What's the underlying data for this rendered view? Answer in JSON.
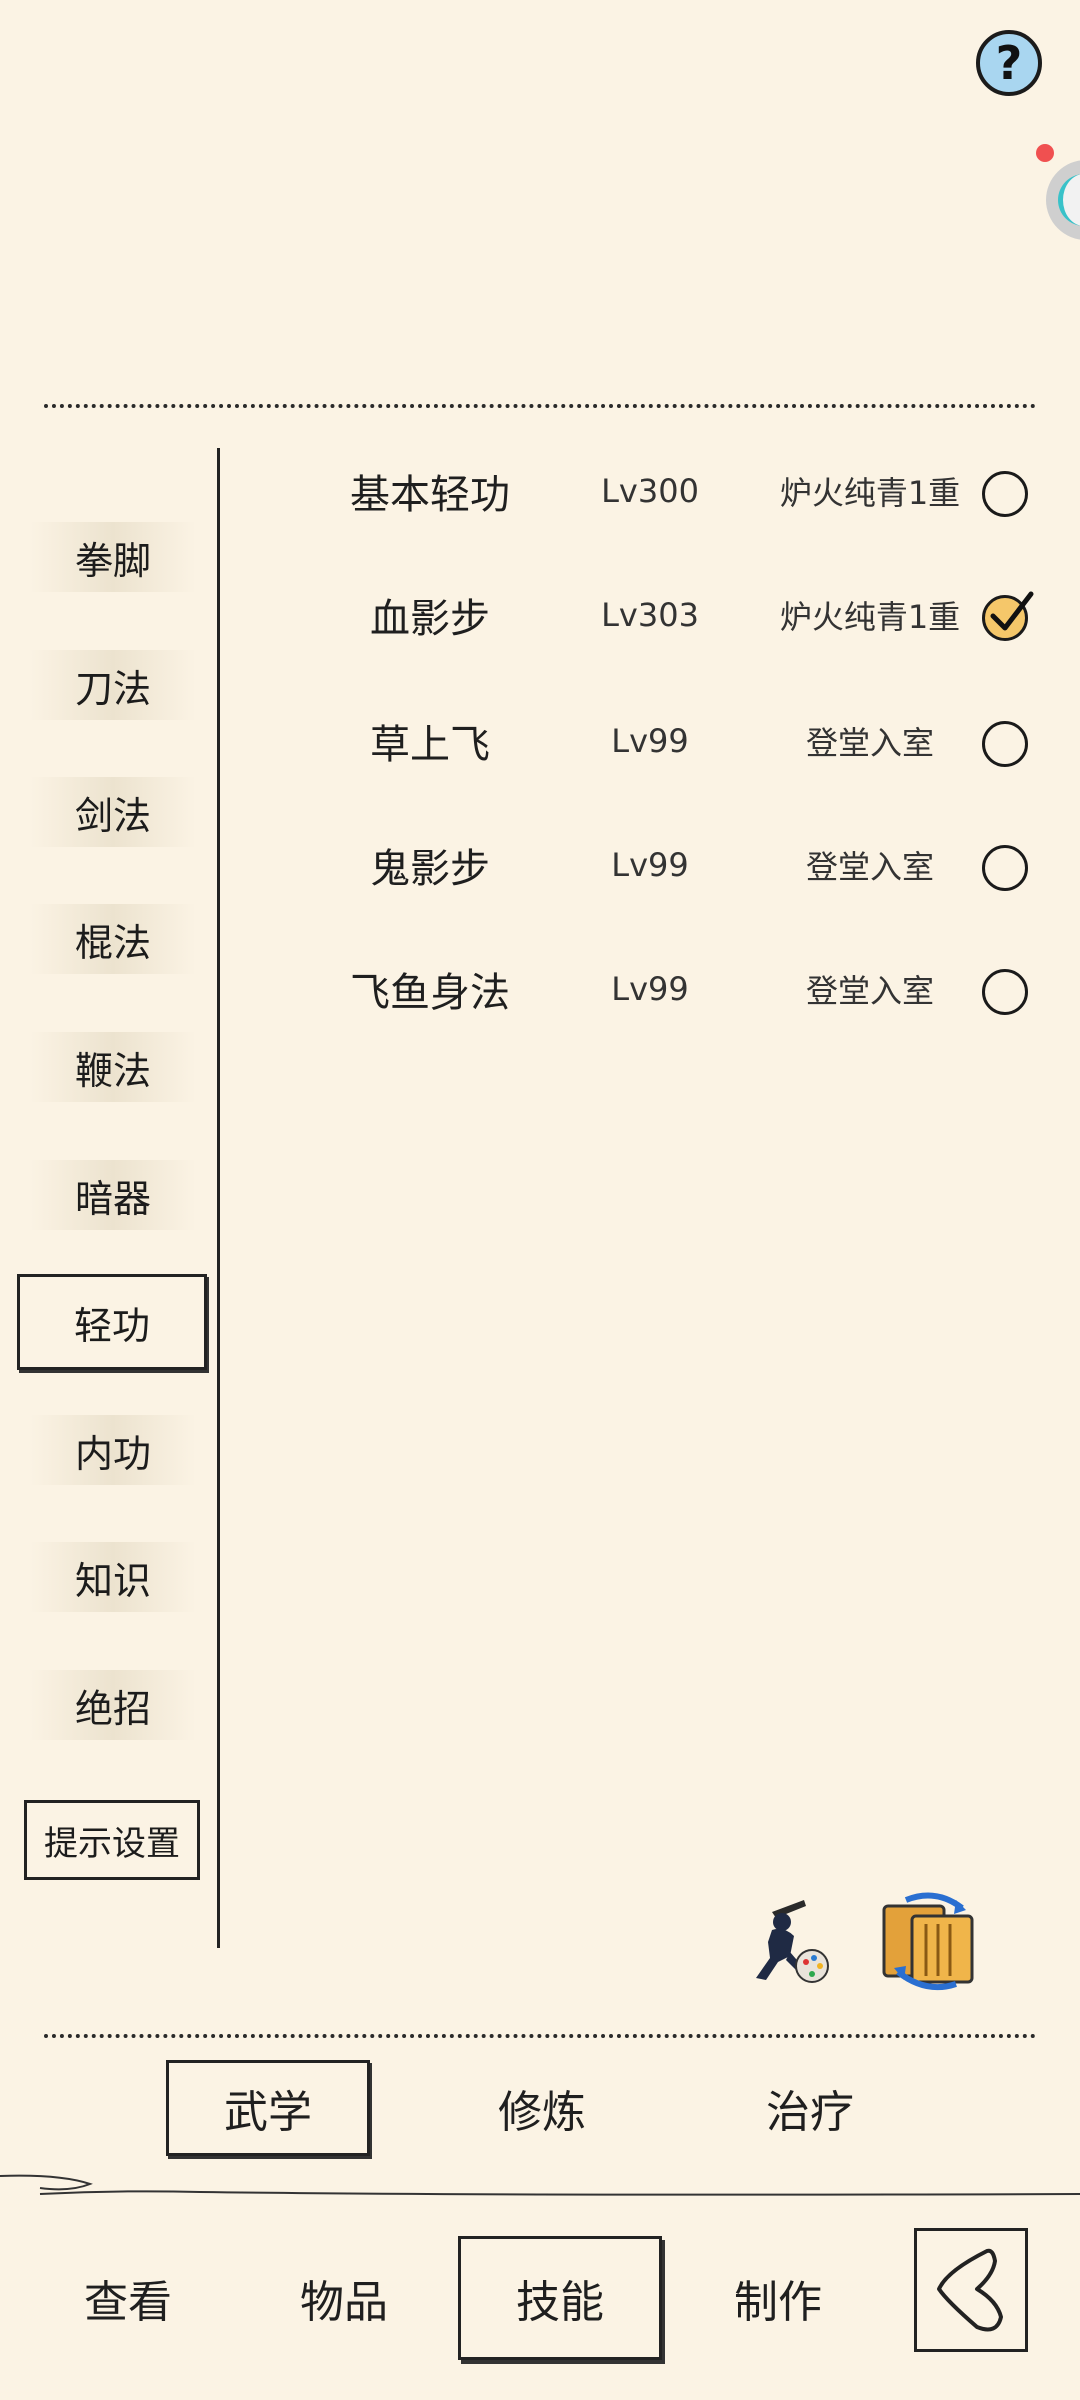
{
  "categories": [
    {
      "label": "拳脚"
    },
    {
      "label": "刀法"
    },
    {
      "label": "剑法"
    },
    {
      "label": "棍法"
    },
    {
      "label": "鞭法"
    },
    {
      "label": "暗器"
    },
    {
      "label": "轻功"
    },
    {
      "label": "内功"
    },
    {
      "label": "知识"
    },
    {
      "label": "绝招"
    },
    {
      "label": "提示设置"
    }
  ],
  "selected_category": "轻功",
  "skills": [
    {
      "name": "基本轻功",
      "level": "Lv300",
      "realm": "炉火纯青1重",
      "selected": false
    },
    {
      "name": "血影步",
      "level": "Lv303",
      "realm": "炉火纯青1重",
      "selected": true
    },
    {
      "name": "草上飞",
      "level": "Lv99",
      "realm": "登堂入室",
      "selected": false
    },
    {
      "name": "鬼影步",
      "level": "Lv99",
      "realm": "登堂入室",
      "selected": false
    },
    {
      "name": "飞鱼身法",
      "level": "Lv99",
      "realm": "登堂入室",
      "selected": false
    }
  ],
  "sub_tabs": [
    {
      "label": "武学"
    },
    {
      "label": "修炼"
    },
    {
      "label": "治疗"
    }
  ],
  "selected_sub_tab": "武学",
  "bottom_nav": [
    {
      "label": "查看"
    },
    {
      "label": "物品"
    },
    {
      "label": "技能"
    },
    {
      "label": "制作"
    }
  ],
  "selected_nav": "技能",
  "icons": {
    "help": "question-icon",
    "ninja": "ninja-palette-icon",
    "scroll": "scroll-swap-icon",
    "back": "back-chevron-icon"
  },
  "help_glyph": "?"
}
